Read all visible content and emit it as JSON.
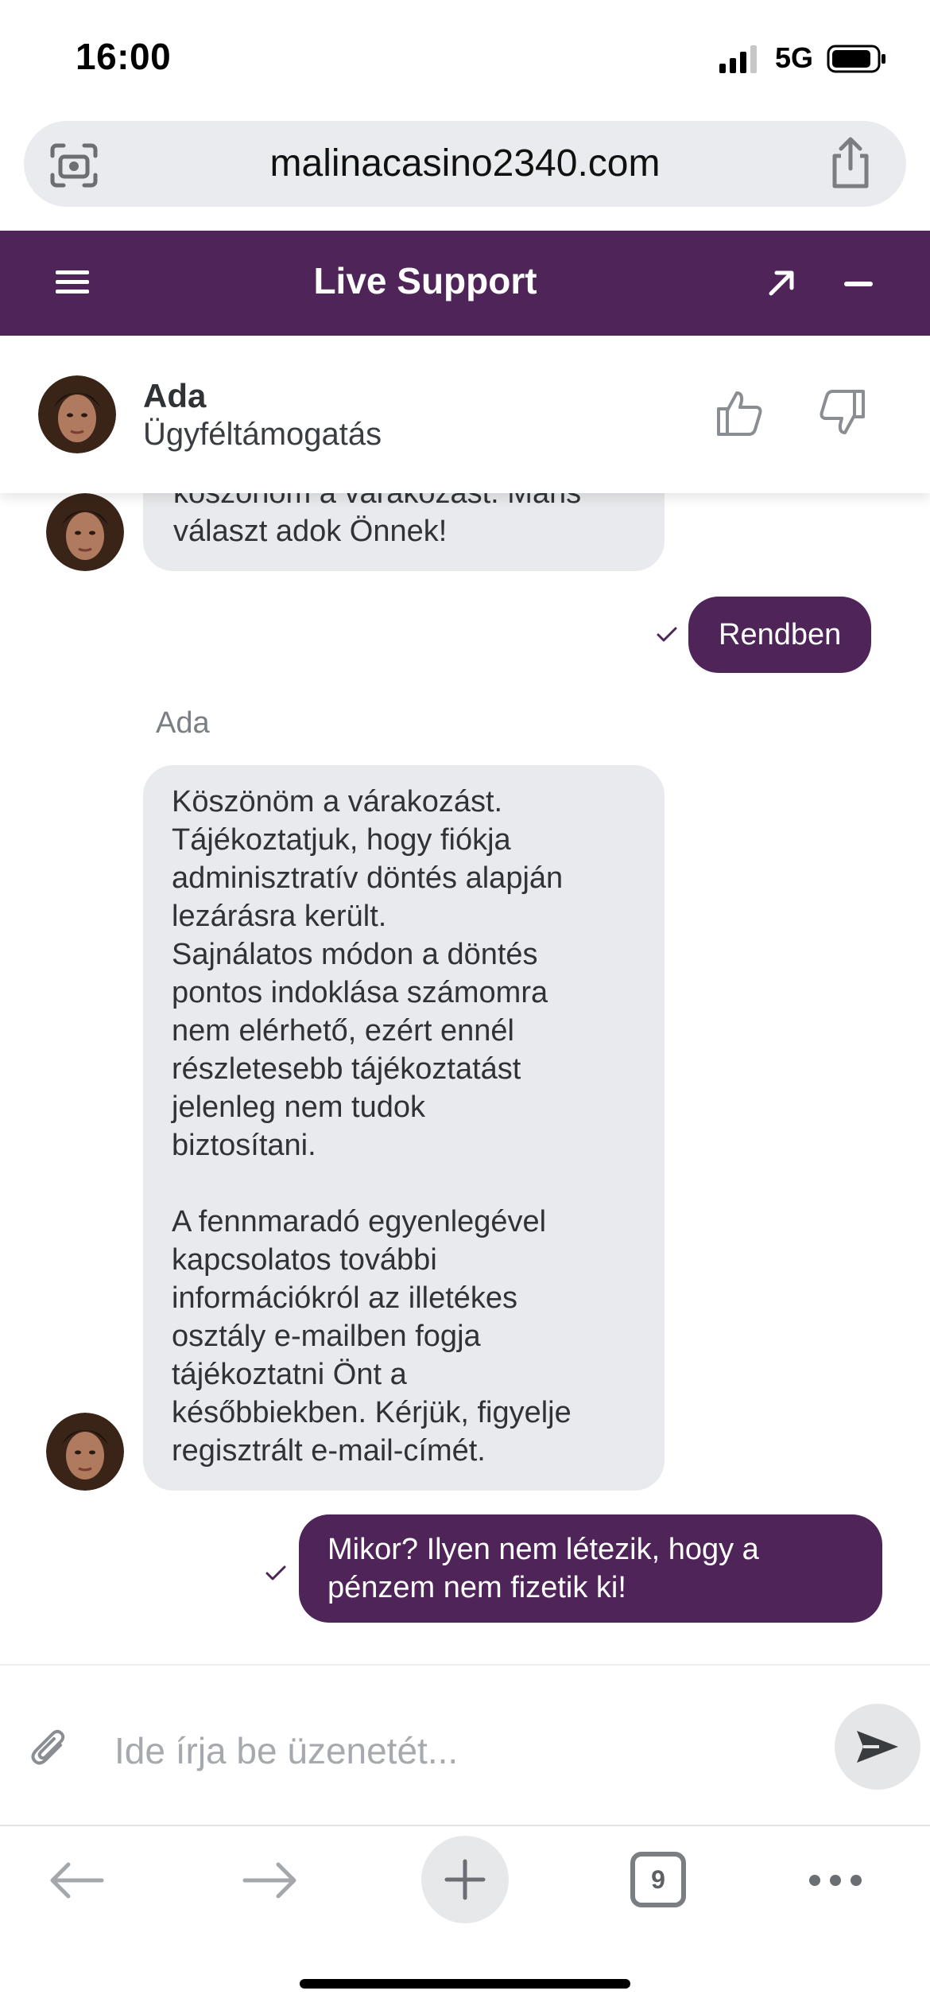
{
  "status_bar": {
    "time": "16:00",
    "network": "5G",
    "signal_icon": "cellular-signal-icon",
    "battery_icon": "battery-icon"
  },
  "browser": {
    "url": "malinacasino2340.com",
    "camera_icon": "camera-scan-icon",
    "share_icon": "share-icon"
  },
  "chat_header": {
    "title": "Live Support",
    "menu_icon": "menu-icon",
    "expand_icon": "expand-arrow-icon",
    "minimize_icon": "minimize-icon"
  },
  "agent": {
    "name": "Ada",
    "role": "Ügyféltámogatás",
    "like_icon": "thumbs-up-icon",
    "dislike_icon": "thumbs-down-icon"
  },
  "messages": [
    {
      "from": "agent",
      "text": "köszönöm a várakozást. Máris\nválaszt adok Önnek!"
    },
    {
      "from": "user",
      "text": "Rendben"
    },
    {
      "from": "agent",
      "sender": "Ada",
      "text": "Köszönöm a várakozást.\nTájékoztatjuk, hogy fiókja\nadminisztratív döntés alapján\nlezárásra került.\nSajnálatos módon a döntés\npontos indoklása számomra\nnem elérhető, ezért ennél\nrészletesebb tájékoztatást\njelenleg nem tudok\nbiztosítani.\n\nA fennmaradó egyenlegével\nkapcsolatos további\ninformációkról az illetékes\nosztály e-mailben fogja\ntájékoztatni Önt a\nkésőbbiekben. Kérjük, figyelje\nregisztrált e-mail-címét."
    },
    {
      "from": "user",
      "text": "Mikor? Ilyen nem létezik, hogy a\npénzem nem fizetik ki!"
    }
  ],
  "composer": {
    "placeholder": "Ide írja be üzenetét...",
    "value": "",
    "attach_icon": "paperclip-icon",
    "send_icon": "send-icon"
  },
  "toolbar": {
    "tab_count": "9",
    "back_icon": "back-arrow-icon",
    "forward_icon": "forward-arrow-icon",
    "new_tab_icon": "plus-icon",
    "more_icon": "more-icon"
  },
  "colors": {
    "brand": "#4f2458",
    "incoming_bubble": "#e9eaed"
  }
}
